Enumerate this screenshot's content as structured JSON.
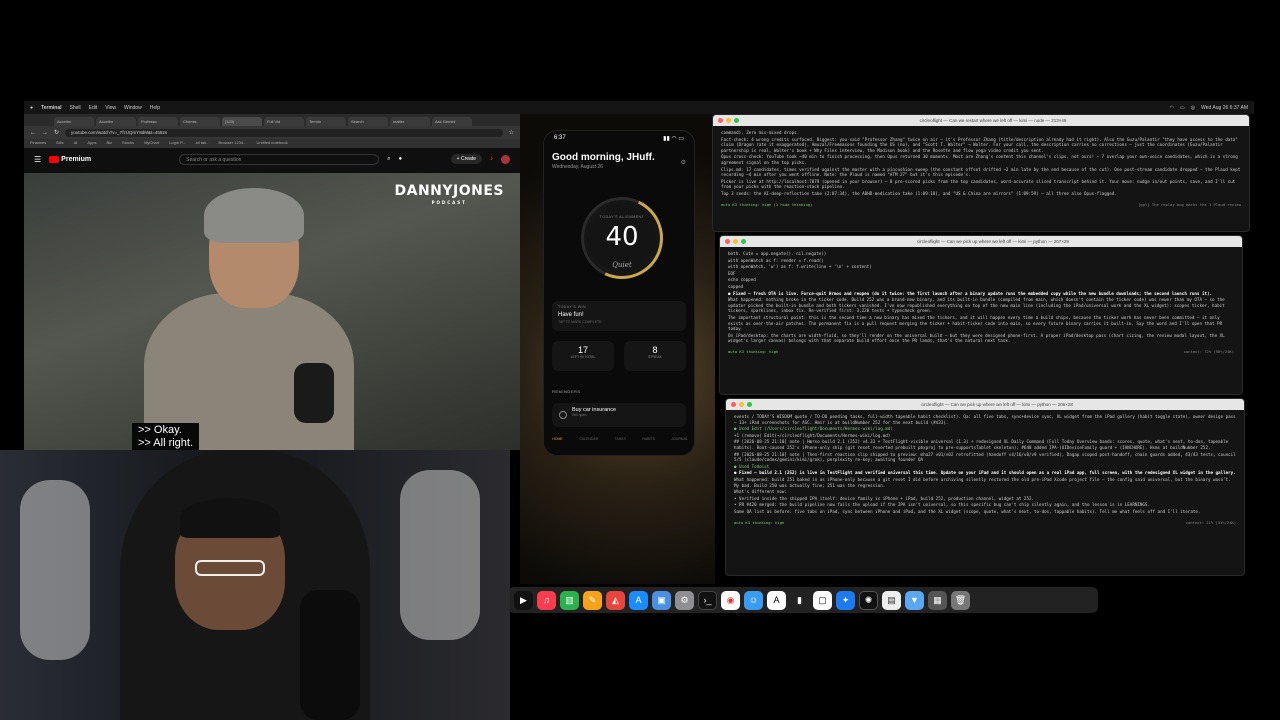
{
  "menubar": {
    "apple": "",
    "app": "Terminal",
    "items": [
      "Shell",
      "Edit",
      "View",
      "Window",
      "Help"
    ],
    "datetime": "Wed Aug 26  6:37 AM"
  },
  "browser": {
    "tabs": [
      "Accelim",
      "Accelim",
      "Professo",
      "Chemis",
      "(120)",
      "Full Vid",
      "Termin",
      "Search",
      "matter",
      "Ask Gemini"
    ],
    "url": "youtube.com/watch?v=_7fzUQmY8dM&t=4582s",
    "bookmarks": [
      "Finances",
      "Bills",
      "AI",
      "Apps",
      "Biz",
      "Stocks",
      "MyChart",
      "Login P...",
      "all tab..",
      "Browser 1234...",
      "Untitled notebook"
    ],
    "yt_brand": "Premium",
    "search_placeholder": "Search or ask a question",
    "create_label": "+ Create"
  },
  "video": {
    "brand_main": "DANNYJONES",
    "brand_sub": "PODCAST",
    "caption_1": ">> Okay.",
    "caption_2": ">> All right."
  },
  "phone": {
    "time": "6:37",
    "greeting": "Good morning, JHuff.",
    "date": "Wednesday, August 26",
    "alignment_label": "TODAY'S ALIGNMENT",
    "alignment_value": "40",
    "alignment_mood": "Quiet",
    "card_kicker": "TODAY'S WIN",
    "card_title": "Have fun!",
    "card_sub": "TAP TO MARK COMPLETE",
    "stat_left_value": "17",
    "stat_left_label": "LEFT IN TOTAL",
    "stat_right_value": "8",
    "stat_right_label": "STREAK",
    "reminders_head": "REMINDERS",
    "reminder_title": "Buy car insurance",
    "reminder_sub": "Still open",
    "nav": [
      "HOME",
      "CALENDAR",
      "TASKS",
      "HABITS",
      "JOURNAL"
    ]
  },
  "terminals": {
    "t1": {
      "title": "circleoflight — Can we restart where we left off — kimi — node — 213×49",
      "lines": [
        "command). Zero mis-mixed drops.",
        "Fact-check: 4 wrong credits surfaced. Biggest: you said \"Professor Zhang\" twice on air — it's Professor Zhang (title/description already had it right). Also the Guzu/Palantir \"they have access to the data\" claim (Dragon rate it exaggerated), Amuzal/Freemasons founding the US (no), and \"Scott T. Walter\" → Walter. For your call, the description carries no corrections — just the coordinates (Guzu/Palantir partnership is real, Walter's book + Why Files interview, the Madison book) and the Rosette and flow yoga video credit you sent.",
        "Opus cross-check: YouTube took ~40 min to finish processing, then Opus returned 30 moments. Most are Zhang's content this channel's clips, not ours! — 7 overlap your own-voice candidates, which is a strong agreement signal on the top picks.",
        "Clips.md: 17 candidates, times verified against the master with a pincushion sweep (the constant offset drifted ~2 min late by the end because of the cut). One post-stream candidate dropped — the Plaud kept recording ~4 min after you went offline. Note: the Plaud is named \"ATM 27\" but it's this episode's.",
        "Picker is live at http://localhost:7879 (opened in your browser) — 8 pre-scored picks from the top candidates, word-accurate sliced transcript behind it. Your move: nudge in/out points, save, and I'll cut from your picks with the reaction-stack pipeline.",
        "",
        "Top 3 seeds: the AI-deep-reflection take (2:07:34), the ADHD-medication take (1:09:18), and \"US & China are mirrors\" (1:09:59) — all three also Opus-flagged."
      ],
      "status_left": "auto  K3 thinking: high  (1 hide thinking)",
      "status_right": "[gpt] The replay-bug marks the 1 Plaud review"
    },
    "t2": {
      "title": "circleoflight — Can we pick up where we left off — kimi — python — 207×29",
      "lines": [
        "  both. Cute = app.negate(). nil.negate()",
        "  with openWatch as f: render = f.read()",
        "  with openWatch, 'w') as f: f.write(line + '\\n' + content)",
        "  EOF",
        "  echo copped",
        "  copped",
        "",
        "● Fixed — fresh OTA is live. Force-quit Hrmos and reopen (do it twice: the first launch after a binary update runs the embedded copy while the new bundle downloads; the second launch runs it).",
        "",
        "What happened: nothing broke in the ticker code. Build 252 was a brand-new binary, and its built-in bundle (compiled from main, which doesn't contain the ticker code) was newer than my OTA — so the updater picked the built-in bundle and both tickers vanished. I've now republished everything on top of the new main line (including the iPad/universal work and the XL widget): scopes ticker, habit tickers, sparklines, inbox fix. Re-verified first: 3,228 tests + typecheck green.",
        "",
        "The important structural point: this is the second time a new binary has mixed the tickers, and it will happen every time a build ships, because the ticker work has never been committed — it only exists as over-the-air patches. The permanent fix is a pull request merging the ticker + habit-ticker code into main, so every future binary carries it built-in. Say the word and I'll open that PR today.",
        "",
        "On iPad/desktop: the charts are width-fluid, so they'll render on the universal build — but they were designed phone-first. A proper iPad/desktop pass (chart sizing, the review modal layout, the XL widget's larger canvas) belongs with that separate build effort once the PR lands, that's the natural next task."
      ],
      "status_left": "auto  K3 thinking: high",
      "status_right": "context: 72% (98%/24K)"
    },
    "t3": {
      "title": "circleoflight — Can we pick up where we left off — kimi — python — 206×28",
      "lines": [
        "events / TODAY'S WISDOM quote / TO-DO pending tasks, full-width tapeable habit checklist). Qa: all five tabs, sync+device sync, XL widget from the iPad gallery (habit toggle state), owner design pass — 13+ iPad screenshots for ASC. Hmir is at buildNumber 252 for the next build (#433).",
        "",
        "● Used  Edit (/Users/circleoflight/Documents/Hermes-wiki/log.md)",
        "  +1 (remove) Edit(~/circleoflight/Documents/Hermes-wiki/log.md)",
        "    ## [2026-08-25 21:10] note | Hmrso build 2.1 (252) v4.33 + TestFlight-visible universal (1.3) + redesigned XL Daily Command (Full Today Overview bands: scores, quote, what's next, to-dos, tapeable habits). Root-caused 252's iPhone-only ship (git reset reverted prebuilt pbxproj to pre-supportsTablet skeleton); #648 added IPA-(UIDeviceFamily guard + (IANCHORE). Hsms at buildNumber 252.",
        "    ## [2026-08-25 21:10] note | Then-first reaction clip shipped to preview: mha27 v01/v02 retrofitted (handoff v4/16/v8/v9 verified), Dagap scoped post-handoff, chain guards added, 43/43 tests; council 5/5 (claude/codex/gemini/kimi/grok), perplexity re-key; awaiting founder QA",
        "",
        "● Used  Todoist",
        "",
        "● Fixed — build 2.1 (252) is live in TestFlight and verified universal this time. Update on your iPad and it should open as a real iPad app, full screen, with the redesigned XL widget in the gallery.",
        "",
        "What happened: build 251 baked in as iPhone-only because a git reset I did before archiving silently restored the old pre-iPad Xcode project file — the config said universal, but the binary wasn't. My bad. Build 250 was actually fine; 251 was the regression.",
        "",
        "What's different now:",
        "  • Verified inside the shipped IPA itself: device family is iPhone + iPad, build 252, production channel, widget at 252.",
        "  • PR #420 merged: the build pipeline now fails the upload if the IPA isn't universal, so this specific bug can't ship silently again, and the lesson is in LEARNINGS.",
        "",
        "Same QA list as before: five tabs on iPad, sync between iPhone and iPad, and the XL widget (scope, quote, what's next, to-dos, tappable habits). Tell me what feels off and I'll iterate."
      ],
      "status_left": "auto  K3 thinking: high",
      "status_right": "context: 21% (31%/24K)"
    }
  },
  "dock": {
    "icons": [
      "tv-app",
      "music-app",
      "numbers-app",
      "pages-app",
      "keynote-app",
      "app-store",
      "preview-app",
      "settings-app",
      "terminal-app",
      "chrome-app",
      "finder-app",
      "font-app",
      "activity-app",
      "codex-app",
      "safari-app",
      "chatgpt-app",
      "document-app",
      "downloads-folder",
      "windows-stack",
      "trash"
    ]
  }
}
